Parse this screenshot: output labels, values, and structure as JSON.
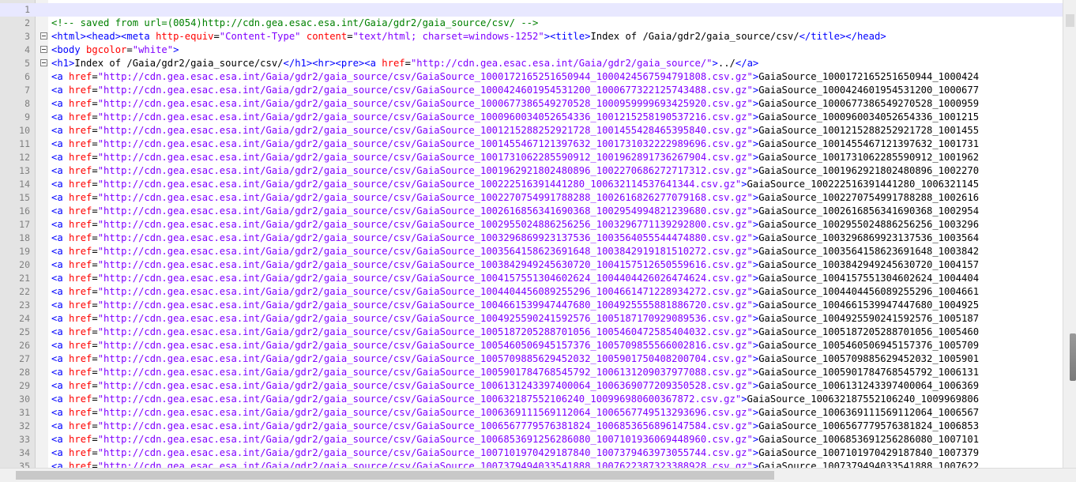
{
  "editor": {
    "lines": [
      {
        "n": "1",
        "parts": []
      },
      {
        "n": "2",
        "parts": [
          {
            "t": "c",
            "s": "<!-- saved from url=(0054)http://cdn.gea.esac.esa.int/Gaia/gdr2/gaia_source/csv/ -->"
          }
        ]
      },
      {
        "n": "3",
        "fold": true,
        "parts": [
          {
            "t": "t",
            "s": "<html><head><meta "
          },
          {
            "t": "a",
            "s": "http-equiv"
          },
          {
            "t": "x",
            "s": "="
          },
          {
            "t": "v",
            "s": "\"Content-Type\""
          },
          {
            "t": "x",
            "s": " "
          },
          {
            "t": "a",
            "s": "content"
          },
          {
            "t": "x",
            "s": "="
          },
          {
            "t": "v",
            "s": "\"text/html; charset=windows-1252\""
          },
          {
            "t": "t",
            "s": "><title>"
          },
          {
            "t": "x",
            "s": "Index of /Gaia/gdr2/gaia_source/csv/"
          },
          {
            "t": "t",
            "s": "</title></head>"
          }
        ]
      },
      {
        "n": "4",
        "fold": true,
        "parts": [
          {
            "t": "t",
            "s": "<body "
          },
          {
            "t": "a",
            "s": "bgcolor"
          },
          {
            "t": "x",
            "s": "="
          },
          {
            "t": "v",
            "s": "\"white\""
          },
          {
            "t": "t",
            "s": ">"
          }
        ]
      },
      {
        "n": "5",
        "fold": true,
        "parts": [
          {
            "t": "t",
            "s": "<h1>"
          },
          {
            "t": "x",
            "s": "Index of /Gaia/gdr2/gaia_source/csv/"
          },
          {
            "t": "t",
            "s": "</h1><hr><pre><a "
          },
          {
            "t": "a",
            "s": "href"
          },
          {
            "t": "x",
            "s": "="
          },
          {
            "t": "v",
            "s": "\"http://cdn.gea.esac.esa.int/Gaia/gdr2/gaia_source/\""
          },
          {
            "t": "t",
            "s": ">"
          },
          {
            "t": "x",
            "s": "../"
          },
          {
            "t": "t",
            "s": "</a>"
          }
        ]
      },
      {
        "n": "6",
        "f": "GaiaSource_1000172165251650944_1000424567594791808.csv.gz",
        "d": "GaiaSource_1000172165251650944_1000424"
      },
      {
        "n": "7",
        "f": "GaiaSource_1000424601954531200_1000677322125743488.csv.gz",
        "d": "GaiaSource_1000424601954531200_1000677"
      },
      {
        "n": "8",
        "f": "GaiaSource_1000677386549270528_1000959999693425920.csv.gz",
        "d": "GaiaSource_1000677386549270528_1000959"
      },
      {
        "n": "9",
        "f": "GaiaSource_1000960034052654336_1001215258190537216.csv.gz",
        "d": "GaiaSource_1000960034052654336_1001215"
      },
      {
        "n": "10",
        "f": "GaiaSource_1001215288252921728_1001455428465395840.csv.gz",
        "d": "GaiaSource_1001215288252921728_1001455"
      },
      {
        "n": "11",
        "f": "GaiaSource_1001455467121397632_1001731032222989696.csv.gz",
        "d": "GaiaSource_1001455467121397632_1001731"
      },
      {
        "n": "12",
        "f": "GaiaSource_1001731062285590912_1001962891736267904.csv.gz",
        "d": "GaiaSource_1001731062285590912_1001962"
      },
      {
        "n": "13",
        "f": "GaiaSource_1001962921802480896_1002270686272717312.csv.gz",
        "d": "GaiaSource_1001962921802480896_1002270"
      },
      {
        "n": "14",
        "f": "GaiaSource_100222516391441280_100632114537641344.csv.gz",
        "d": "GaiaSource_100222516391441280_1006321145"
      },
      {
        "n": "15",
        "f": "GaiaSource_1002270754991788288_1002616826277079168.csv.gz",
        "d": "GaiaSource_1002270754991788288_1002616"
      },
      {
        "n": "16",
        "f": "GaiaSource_1002616856341690368_1002954994821239680.csv.gz",
        "d": "GaiaSource_1002616856341690368_1002954"
      },
      {
        "n": "17",
        "f": "GaiaSource_1002955024886256256_1003296771139292800.csv.gz",
        "d": "GaiaSource_1002955024886256256_1003296"
      },
      {
        "n": "18",
        "f": "GaiaSource_1003296869923137536_1003564055544474880.csv.gz",
        "d": "GaiaSource_1003296869923137536_1003564"
      },
      {
        "n": "19",
        "f": "GaiaSource_1003564158623691648_1003842919181510272.csv.gz",
        "d": "GaiaSource_1003564158623691648_1003842"
      },
      {
        "n": "20",
        "f": "GaiaSource_1003842949245630720_1004157512650559616.csv.gz",
        "d": "GaiaSource_1003842949245630720_1004157"
      },
      {
        "n": "21",
        "f": "GaiaSource_1004157551304602624_1004404426026474624.csv.gz",
        "d": "GaiaSource_1004157551304602624_1004404"
      },
      {
        "n": "22",
        "f": "GaiaSource_1004404456089255296_1004661471228934272.csv.gz",
        "d": "GaiaSource_1004404456089255296_1004661"
      },
      {
        "n": "23",
        "f": "GaiaSource_1004661539947447680_1004925555881886720.csv.gz",
        "d": "GaiaSource_1004661539947447680_1004925"
      },
      {
        "n": "24",
        "f": "GaiaSource_1004925590241592576_1005187170929089536.csv.gz",
        "d": "GaiaSource_1004925590241592576_1005187"
      },
      {
        "n": "25",
        "f": "GaiaSource_1005187205288701056_1005460472585404032.csv.gz",
        "d": "GaiaSource_1005187205288701056_1005460"
      },
      {
        "n": "26",
        "f": "GaiaSource_1005460506945157376_1005709855566002816.csv.gz",
        "d": "GaiaSource_1005460506945157376_1005709"
      },
      {
        "n": "27",
        "f": "GaiaSource_1005709885629452032_1005901750408200704.csv.gz",
        "d": "GaiaSource_1005709885629452032_1005901"
      },
      {
        "n": "28",
        "f": "GaiaSource_1005901784768545792_1006131209037977088.csv.gz",
        "d": "GaiaSource_1005901784768545792_1006131"
      },
      {
        "n": "29",
        "f": "GaiaSource_1006131243397400064_1006369077209350528.csv.gz",
        "d": "GaiaSource_1006131243397400064_1006369"
      },
      {
        "n": "30",
        "f": "GaiaSource_100632187552106240_100996980600367872.csv.gz",
        "d": "GaiaSource_100632187552106240_1009969806"
      },
      {
        "n": "31",
        "f": "GaiaSource_1006369111569112064_1006567749513293696.csv.gz",
        "d": "GaiaSource_1006369111569112064_1006567"
      },
      {
        "n": "32",
        "f": "GaiaSource_1006567779576381824_1006853656896147584.csv.gz",
        "d": "GaiaSource_1006567779576381824_1006853"
      },
      {
        "n": "33",
        "f": "GaiaSource_1006853691256286080_1007101936069448960.csv.gz",
        "d": "GaiaSource_1006853691256286080_1007101"
      },
      {
        "n": "34",
        "f": "GaiaSource_1007101970429187840_1007379463973055744.csv.gz",
        "d": "GaiaSource_1007101970429187840_1007379"
      },
      {
        "n": "35",
        "f": "GaiaSource_1007379494033541888_1007622387323388928.csv.gz",
        "d": "GaiaSource_1007379494033541888_1007622"
      }
    ],
    "href_attr": "href",
    "base_url": "http://cdn.gea.esac.esa.int/Gaia/gdr2/gaia_source/csv/"
  },
  "colors": {
    "tag": "#0000ff",
    "attribute": "#ff0000",
    "value": "#8000ff",
    "comment": "#008000",
    "current_line": "#e8e8ff"
  }
}
